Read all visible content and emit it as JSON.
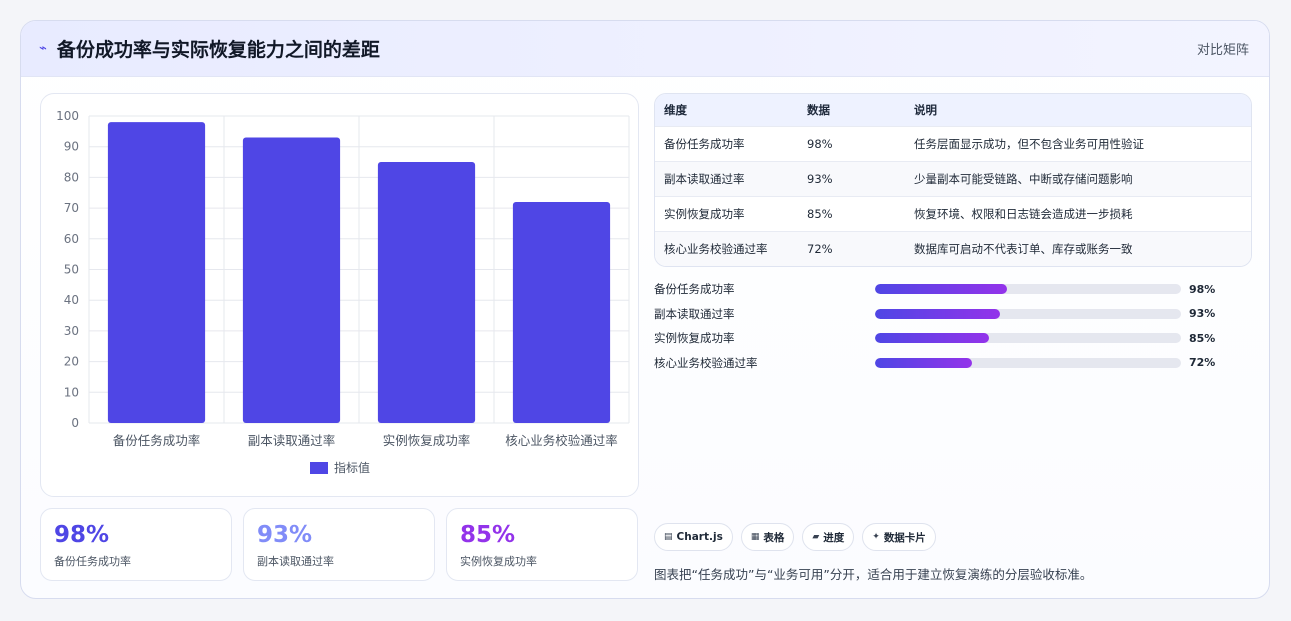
{
  "header": {
    "title": "备份成功率与实际恢复能力之间的差距",
    "right_label": "对比矩阵"
  },
  "colors": {
    "bar": "#4f46e5",
    "accent_blue": "#4f46e5",
    "accent_lavender": "#818cf8",
    "accent_purple": "#9333ea"
  },
  "chart_data": {
    "type": "bar",
    "categories": [
      "备份任务成功率",
      "副本读取通过率",
      "实例恢复成功率",
      "核心业务校验通过率"
    ],
    "series": [
      {
        "name": "指标值",
        "values": [
          98,
          93,
          85,
          72
        ]
      }
    ],
    "ylim": [
      0,
      100
    ],
    "yticks": [
      0,
      10,
      20,
      30,
      40,
      50,
      60,
      70,
      80,
      90,
      100
    ],
    "grid": true,
    "legend": "bottom"
  },
  "stats": [
    {
      "value": "98%",
      "label": "备份任务成功率",
      "color": "#4f46e5"
    },
    {
      "value": "93%",
      "label": "副本读取通过率",
      "color": "#818cf8"
    },
    {
      "value": "85%",
      "label": "实例恢复成功率",
      "color": "#9333ea"
    }
  ],
  "table": {
    "headers": [
      "维度",
      "数据",
      "说明"
    ],
    "rows": [
      [
        "备份任务成功率",
        "98%",
        "任务层面显示成功，但不包含业务可用性验证"
      ],
      [
        "副本读取通过率",
        "93%",
        "少量副本可能受链路、中断或存储问题影响"
      ],
      [
        "实例恢复成功率",
        "85%",
        "恢复环境、权限和日志链会造成进一步损耗"
      ],
      [
        "核心业务校验通过率",
        "72%",
        "数据库可启动不代表订单、库存或账务一致"
      ]
    ]
  },
  "progress": [
    {
      "label": "备份任务成功率",
      "value": 98,
      "display": "98%"
    },
    {
      "label": "副本读取通过率",
      "value": 93,
      "display": "93%"
    },
    {
      "label": "实例恢复成功率",
      "value": 85,
      "display": "85%"
    },
    {
      "label": "核心业务校验通过率",
      "value": 72,
      "display": "72%"
    }
  ],
  "tags": [
    {
      "icon": "chart-icon",
      "glyph": "▤",
      "label": "Chart.js"
    },
    {
      "icon": "table-icon",
      "glyph": "▦",
      "label": "表格"
    },
    {
      "icon": "progress-icon",
      "glyph": "▰",
      "label": "进度"
    },
    {
      "icon": "card-icon",
      "glyph": "✦",
      "label": "数据卡片"
    }
  ],
  "footnote": "图表把“任务成功”与“业务可用”分开，适合用于建立恢复演练的分层验收标准。"
}
